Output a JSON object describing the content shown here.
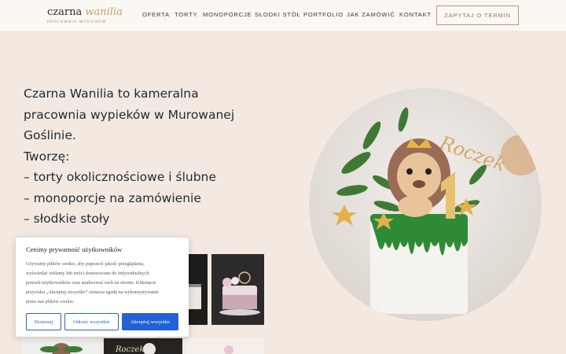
{
  "header": {
    "logo": {
      "main": "czarna",
      "accent": "wanilia",
      "tagline": "PRACOWNIA WYPIEKÓW"
    },
    "nav": [
      "OFERTA",
      "TORTY",
      "MONOPORCJE",
      "SŁODKI STÓŁ",
      "PORTFOLIO",
      "JAK ZAMÓWIĆ",
      "KONTAKT"
    ],
    "cta": "ZAPYTAJ O TERMIN"
  },
  "hero": {
    "lines": [
      "Czarna Wanilia to kameralna",
      "pracownia wypieków w Murowanej",
      "Goślinie.",
      "Tworzę:",
      " – torty okolicznościowe i ślubne",
      " – monoporcje na zamówienie",
      " – słodkie stoły"
    ]
  },
  "cake_image": {
    "topper_text": "Roczek"
  },
  "gallery": {
    "thumb_label": "Roczek"
  },
  "cookie": {
    "title": "Cenimy prywatność użytkowników",
    "text_lines": [
      "Używamy plików cookie, aby poprawić jakość przeglądania,",
      "wyświetlać reklamy lub treści dostosowane do indywidualnych",
      "potrzeb użytkowników oraz analizować ruch na stronie. Kliknięcie",
      "przycisku „Akceptuj wszystko” oznacza zgodę na wykorzystywanie",
      "przez nas plików cookie."
    ],
    "buttons": {
      "customize": "Dostosuj",
      "reject": "Odrzuć wszystkie",
      "accept": "Akceptuj wszystko"
    }
  },
  "colors": {
    "background": "#f3e9e1",
    "header": "#fbf7f3",
    "gold": "#b59a6d",
    "accept": "#2261d6"
  }
}
